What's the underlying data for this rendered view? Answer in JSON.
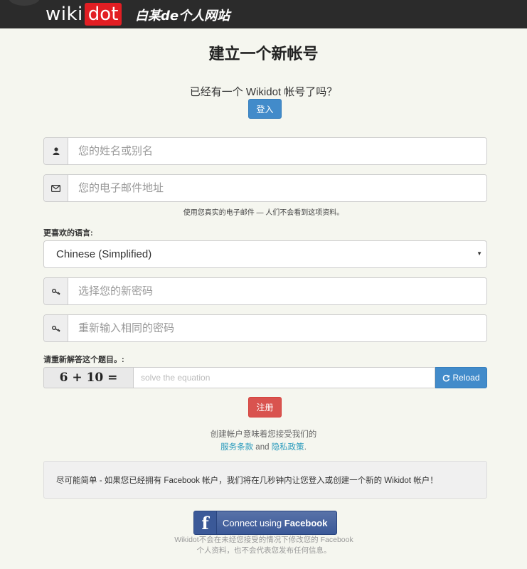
{
  "header": {
    "logo_wiki": "wiki",
    "logo_dot": "dot",
    "site_name": "白某de个人网站"
  },
  "page": {
    "title": "建立一个新帐号",
    "already_have": "已经有一个 Wikidot 帐号了吗？",
    "login_button": "登入"
  },
  "form": {
    "name_placeholder": "您的姓名或别名",
    "email_placeholder": "您的电子邮件地址",
    "email_hint": "使用您真实的电子邮件 — 人们不会看到这项资料。",
    "language_label": "更喜欢的语言:",
    "language_selected": "Chinese (Simplified)",
    "password_placeholder": "选择您的新密码",
    "password_repeat_placeholder": "重新输入相同的密码",
    "captcha_label": "请重新解答这个题目。:",
    "captcha_equation": "6 + 10 =",
    "captcha_placeholder": "solve the equation",
    "reload_label": "Reload",
    "register_button": "注册"
  },
  "terms": {
    "line1": "创建帐户意味着您接受我们的",
    "tos_link": "服务条款",
    "and": "and",
    "privacy_link": "隐私政策",
    "period": "."
  },
  "facebook": {
    "info_text": "尽可能简单 - 如果您已经拥有 Facebook 帐户，我们将在几秒钟内让您登入或创建一个新的 Wikidot 帐户！",
    "button_prefix": "Connect using",
    "button_brand": "Facebook",
    "logo_letter": "f",
    "note": "Wikidot不会在未经您接受的情况下修改您的 Facebook 个人资料，也不会代表您发布任何信息。"
  },
  "colors": {
    "primary": "#428bca",
    "danger": "#d9534f",
    "facebook": "#3b5998",
    "logo_red": "#e21e23"
  }
}
